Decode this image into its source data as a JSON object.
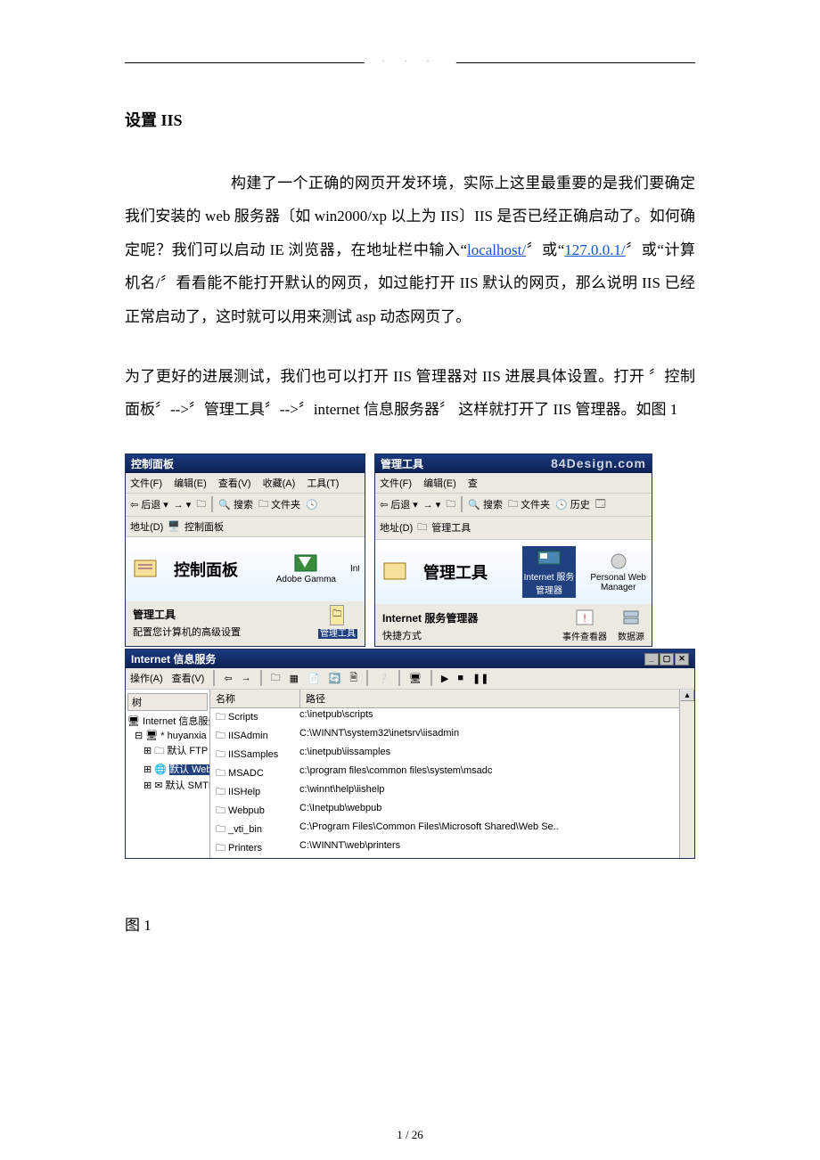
{
  "heading": "设置 IIS",
  "paragraph1_prefix": "构建了一个正确的网页开发环境，实际上这里最重要的是我们要确定我们安装的 web 服务器〔如 win2000/xp 以上为 IIS〕IIS 是否已经正确启动了。如何确定呢？我们可以启动 IE 浏览器，在地址栏中输入“",
  "link_localhost": "localhost/",
  "paragraph1_mid": "〞或“",
  "link_127": "127.0.0.1/",
  "paragraph1_suffix": "〞或“计算机名/〞看看能不能打开默认的网页，如过能打开 IIS 默认的网页，那么说明 IIS 已经正常启动了，这时就可以用来测试 asp 动态网页了。",
  "paragraph2": "为了更好的进展测试，我们也可以打开 IIS 管理器对 IIS 进展具体设置。打开 〞控制面板〞-->〞管理工具〞-->〞internet 信息服务器〞 这样就打开了 IIS 管理器。如图 1",
  "caption_fig": "图 1",
  "page_num": "1 / 26",
  "win1": {
    "title": "控制面板",
    "menu": [
      "文件(F)",
      "编辑(E)",
      "查看(V)",
      "收藏(A)",
      "工具(T)"
    ],
    "back": "后退",
    "search": "搜索",
    "folders": "文件夹",
    "addr_label": "地址(D)",
    "addr_val": "控制面板",
    "banner": "控制面板",
    "adobe": "Adobe Gamma",
    "int": "Int",
    "mgmt_tools": "管理工具",
    "mgmt_desc": "配置您计算机的高级设置",
    "mgmt_icon": "管理工具"
  },
  "win2": {
    "title": "管理工具",
    "menu": [
      "文件(F)",
      "编辑(E)",
      "查"
    ],
    "back": "后退",
    "search": "搜索",
    "folders": "文件夹",
    "history": "历史",
    "addr_label": "地址(D)",
    "addr_val": "管理工具",
    "banner": "管理工具",
    "icon_iis_l1": "Internet 服务",
    "icon_iis_l2": "管理器",
    "icon_pwm_l1": "Personal Web",
    "icon_pwm_l2": "Manager",
    "sub_title": "Internet 服务管理器",
    "sub_desc": "快捷方式",
    "icon_ev": "事件查看器",
    "icon_ds_l1": "数据源"
  },
  "iis": {
    "title": "Internet 信息服务",
    "action": "操作(A)",
    "view": "查看(V)",
    "tree_head": "树",
    "tree_root": "Internet 信息服务",
    "tree_host": "* huyanxia",
    "tree_ftp": "默认 FTP 站点",
    "tree_web": "默认 Web 站点",
    "tree_smtp": "默认 SMTP 虚拟服务器",
    "col_name": "名称",
    "col_path": "路径",
    "rows": [
      {
        "n": "Scripts",
        "p": "c:\\inetpub\\scripts"
      },
      {
        "n": "IISAdmin",
        "p": "C:\\WINNT\\system32\\inetsrv\\iisadmin"
      },
      {
        "n": "IISSamples",
        "p": "c:\\inetpub\\iissamples"
      },
      {
        "n": "MSADC",
        "p": "c:\\program files\\common files\\system\\msadc"
      },
      {
        "n": "IISHelp",
        "p": "c:\\winnt\\help\\iishelp"
      },
      {
        "n": "Webpub",
        "p": "C:\\Inetpub\\webpub"
      },
      {
        "n": "_vti_bin",
        "p": "C:\\Program Files\\Common Files\\Microsoft Shared\\Web Se.."
      },
      {
        "n": "Printers",
        "p": "C:\\WINNT\\web\\printers"
      }
    ]
  }
}
